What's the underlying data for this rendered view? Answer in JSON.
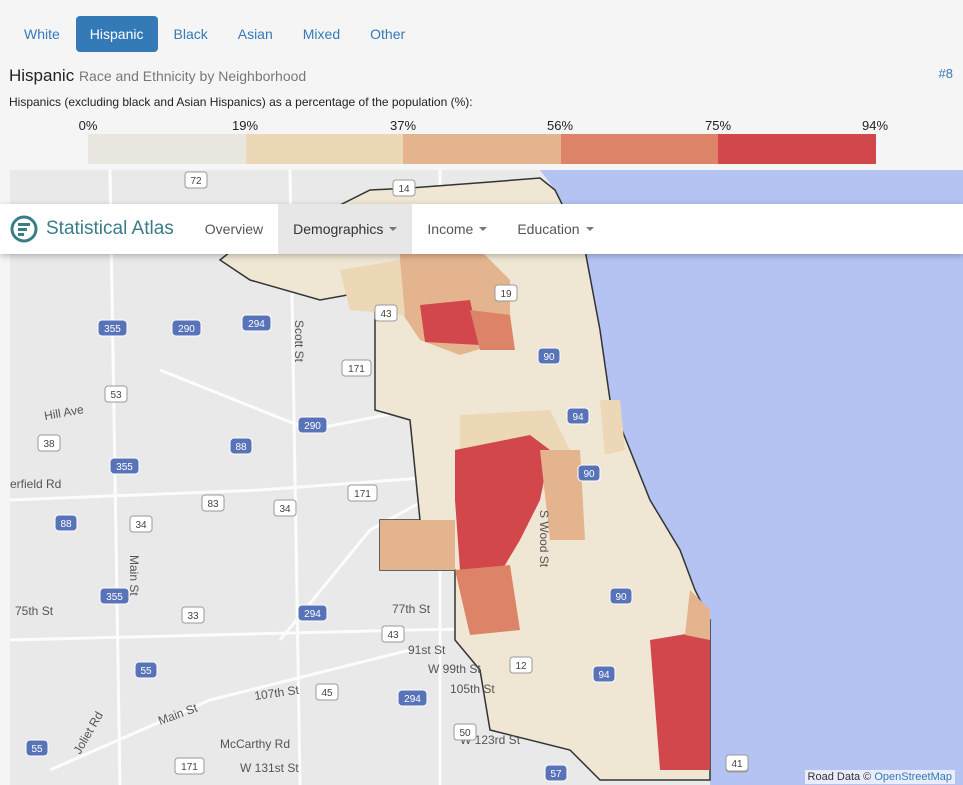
{
  "tabs": [
    "White",
    "Hispanic",
    "Black",
    "Asian",
    "Mixed",
    "Other"
  ],
  "active_tab": 1,
  "title": {
    "main": "Hispanic",
    "sub": "Race and Ethnicity by Neighborhood",
    "ref": "#8"
  },
  "description": "Hispanics (excluding black and Asian Hispanics) as a percentage of the population (%):",
  "legend": {
    "ticks": [
      "0%",
      "19%",
      "37%",
      "56%",
      "75%",
      "94%"
    ],
    "colors": [
      "#e8e6df",
      "#ecd7b6",
      "#e4b48f",
      "#dd8468",
      "#d2474b"
    ]
  },
  "navbar": {
    "brand": "Statistical Atlas",
    "items": [
      {
        "label": "Overview",
        "dropdown": false,
        "active": false
      },
      {
        "label": "Demographics",
        "dropdown": true,
        "active": true
      },
      {
        "label": "Income",
        "dropdown": true,
        "active": false
      },
      {
        "label": "Education",
        "dropdown": true,
        "active": false
      }
    ]
  },
  "map": {
    "water_color": "#b4c3f2",
    "land_color": "#e9e9e9",
    "road_labels": [
      "Scott St",
      "Hill Ave",
      "S Wood St",
      "Main St",
      "75th St",
      "77th St",
      "91st St",
      "W 99th St",
      "105th St",
      "107th St",
      "Main St",
      "McCarthy Rd",
      "W 123rd St",
      "W 131st St",
      "Joliet Rd",
      "erfield Rd"
    ],
    "route_shields": [
      "72",
      "14",
      "19",
      "43",
      "290",
      "294",
      "355",
      "171",
      "90",
      "53",
      "38",
      "290",
      "88",
      "94",
      "355",
      "171",
      "83",
      "34",
      "90",
      "34",
      "88",
      "33",
      "355",
      "294",
      "12",
      "90",
      "43",
      "294",
      "55",
      "45",
      "50",
      "57",
      "41",
      "171",
      "55",
      "41",
      "94"
    ]
  },
  "attribution": {
    "text": "Road Data ©",
    "link": "OpenStreetMap"
  }
}
